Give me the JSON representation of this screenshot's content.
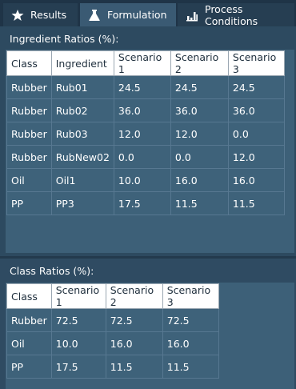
{
  "tabs": [
    {
      "label": "Results",
      "icon": "star-icon"
    },
    {
      "label": "Formulation",
      "icon": "flask-icon"
    },
    {
      "label": "Process Conditions",
      "icon": "bar-chart-icon"
    }
  ],
  "active_tab": "Formulation",
  "ingredient_section": {
    "title": "Ingredient Ratios (%):",
    "columns": [
      "Class",
      "Ingredient",
      "Scenario 1",
      "Scenario 2",
      "Scenario 3"
    ],
    "rows": [
      [
        "Rubber",
        "Rub01",
        "24.5",
        "24.5",
        "24.5"
      ],
      [
        "Rubber",
        "Rub02",
        "36.0",
        "36.0",
        "36.0"
      ],
      [
        "Rubber",
        "Rub03",
        "12.0",
        "12.0",
        "0.0"
      ],
      [
        "Rubber",
        "RubNew02",
        "0.0",
        "0.0",
        "12.0"
      ],
      [
        "Oil",
        "Oil1",
        "10.0",
        "16.0",
        "16.0"
      ],
      [
        "PP",
        "PP3",
        "17.5",
        "11.5",
        "11.5"
      ]
    ]
  },
  "class_section": {
    "title": "Class Ratios (%):",
    "columns": [
      "Class",
      "Scenario 1",
      "Scenario 2",
      "Scenario 3"
    ],
    "rows": [
      [
        "Rubber",
        "72.5",
        "72.5",
        "72.5"
      ],
      [
        "Oil",
        "10.0",
        "16.0",
        "16.0"
      ],
      [
        "PP",
        "17.5",
        "11.5",
        "11.5"
      ]
    ]
  }
}
